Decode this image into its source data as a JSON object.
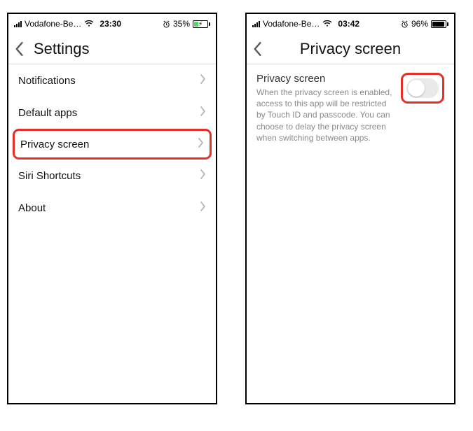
{
  "left": {
    "status": {
      "carrier": "Vodafone-Be…",
      "time": "23:30",
      "battery_text": "35%",
      "battery_fill_pct": 35,
      "battery_fill_color": "#4cd964",
      "charging": true
    },
    "nav": {
      "title": "Settings"
    },
    "rows": [
      {
        "label": "Notifications"
      },
      {
        "label": "Default apps"
      },
      {
        "label": "Privacy screen",
        "highlighted": true
      },
      {
        "label": "Siri Shortcuts"
      },
      {
        "label": "About"
      }
    ]
  },
  "right": {
    "status": {
      "carrier": "Vodafone-Be…",
      "time": "03:42",
      "battery_text": "96%",
      "battery_fill_pct": 96,
      "battery_fill_color": "#000",
      "charging": false
    },
    "nav": {
      "title": "Privacy screen"
    },
    "detail": {
      "title": "Privacy screen",
      "description": "When the privacy screen is enabled, access to this app will be restricted by Touch ID and passcode. You can choose to delay the privacy screen when switching between apps.",
      "toggle_on": false
    }
  },
  "highlight_color": "#e3302a"
}
